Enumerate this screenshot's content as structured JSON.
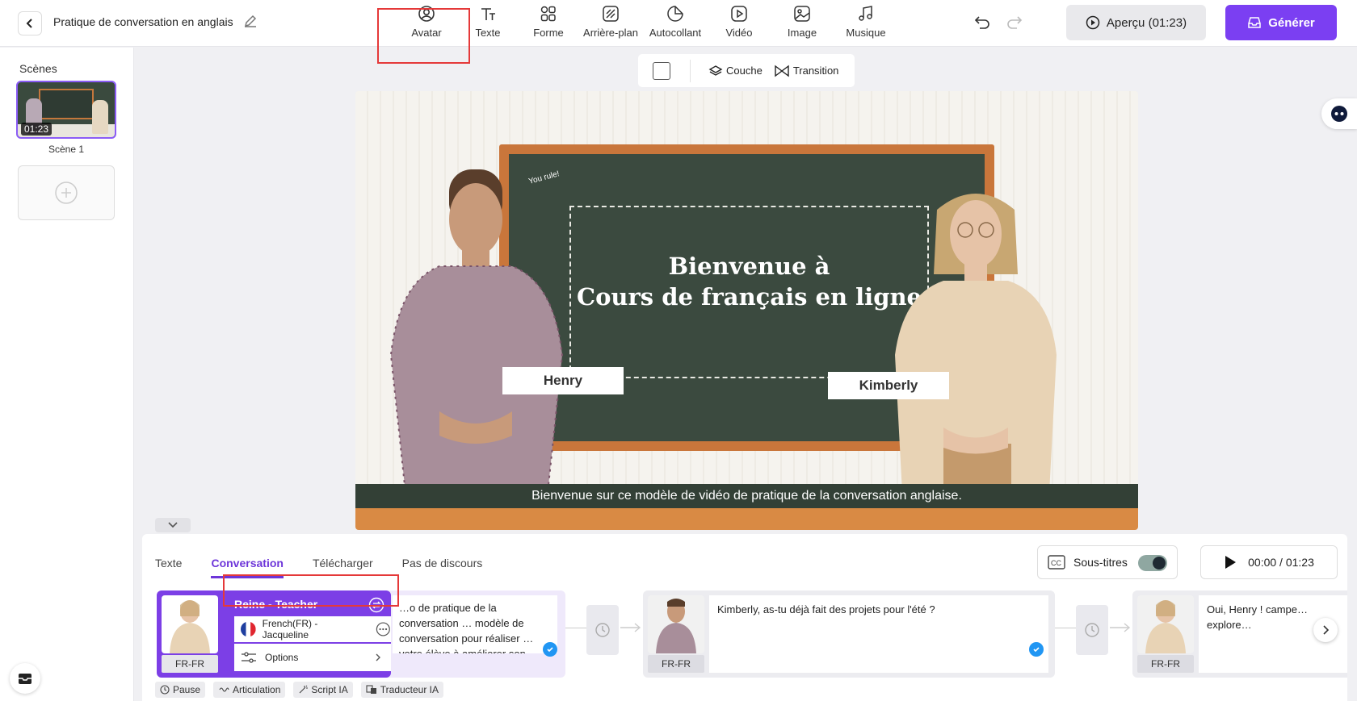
{
  "header": {
    "back_icon": "chevron-left-icon",
    "project_title": "Pratique de conversation en anglais",
    "tools": [
      {
        "label": "Avatar",
        "icon": "avatar-icon"
      },
      {
        "label": "Texte",
        "icon": "text-icon"
      },
      {
        "label": "Forme",
        "icon": "shapes-icon"
      },
      {
        "label": "Arrière-plan",
        "icon": "background-icon"
      },
      {
        "label": "Autocollant",
        "icon": "sticker-icon"
      },
      {
        "label": "Vidéo",
        "icon": "video-icon"
      },
      {
        "label": "Image",
        "icon": "image-icon"
      },
      {
        "label": "Musique",
        "icon": "music-icon"
      }
    ],
    "preview_label": "Aperçu (01:23)",
    "generate_label": "Générer"
  },
  "sidebar": {
    "scenes_label": "Scènes",
    "scenes": [
      {
        "name": "Scène 1",
        "duration": "01:23"
      }
    ]
  },
  "canvas_toolbar": {
    "layer_label": "Couche",
    "transition_label": "Transition"
  },
  "stage": {
    "doodle": "You rule!",
    "board_line1": "Bienvenue à",
    "board_line2": "Cours de français en ligne",
    "left_name": "Henry",
    "right_name": "Kimberly",
    "caption": "Bienvenue sur ce modèle de vidéo de pratique de la conversation anglaise."
  },
  "panel": {
    "tabs": [
      "Texte",
      "Conversation",
      "Télécharger",
      "Pas de discours"
    ],
    "active_tab": "Conversation",
    "subtitles_label": "Sous-titres",
    "time": "00:00 / 01:23",
    "cards": [
      {
        "lang": "FR-FR",
        "text": "…o de pratique de la conversation … modèle de conversation pour réaliser … votre élève à améliorer son anglais."
      },
      {
        "lang": "FR-FR",
        "text": "Kimberly, as-tu déjà fait des projets pour l'été ?"
      },
      {
        "lang": "FR-FR",
        "text": "Oui, Henry ! campe… explore…"
      }
    ],
    "popup": {
      "title": "Reine - Teacher",
      "voice": "French(FR) - Jacqueline",
      "options": "Options"
    },
    "bottom_tags": [
      "Pause",
      "Articulation",
      "Script IA",
      "Traducteur IA"
    ]
  }
}
